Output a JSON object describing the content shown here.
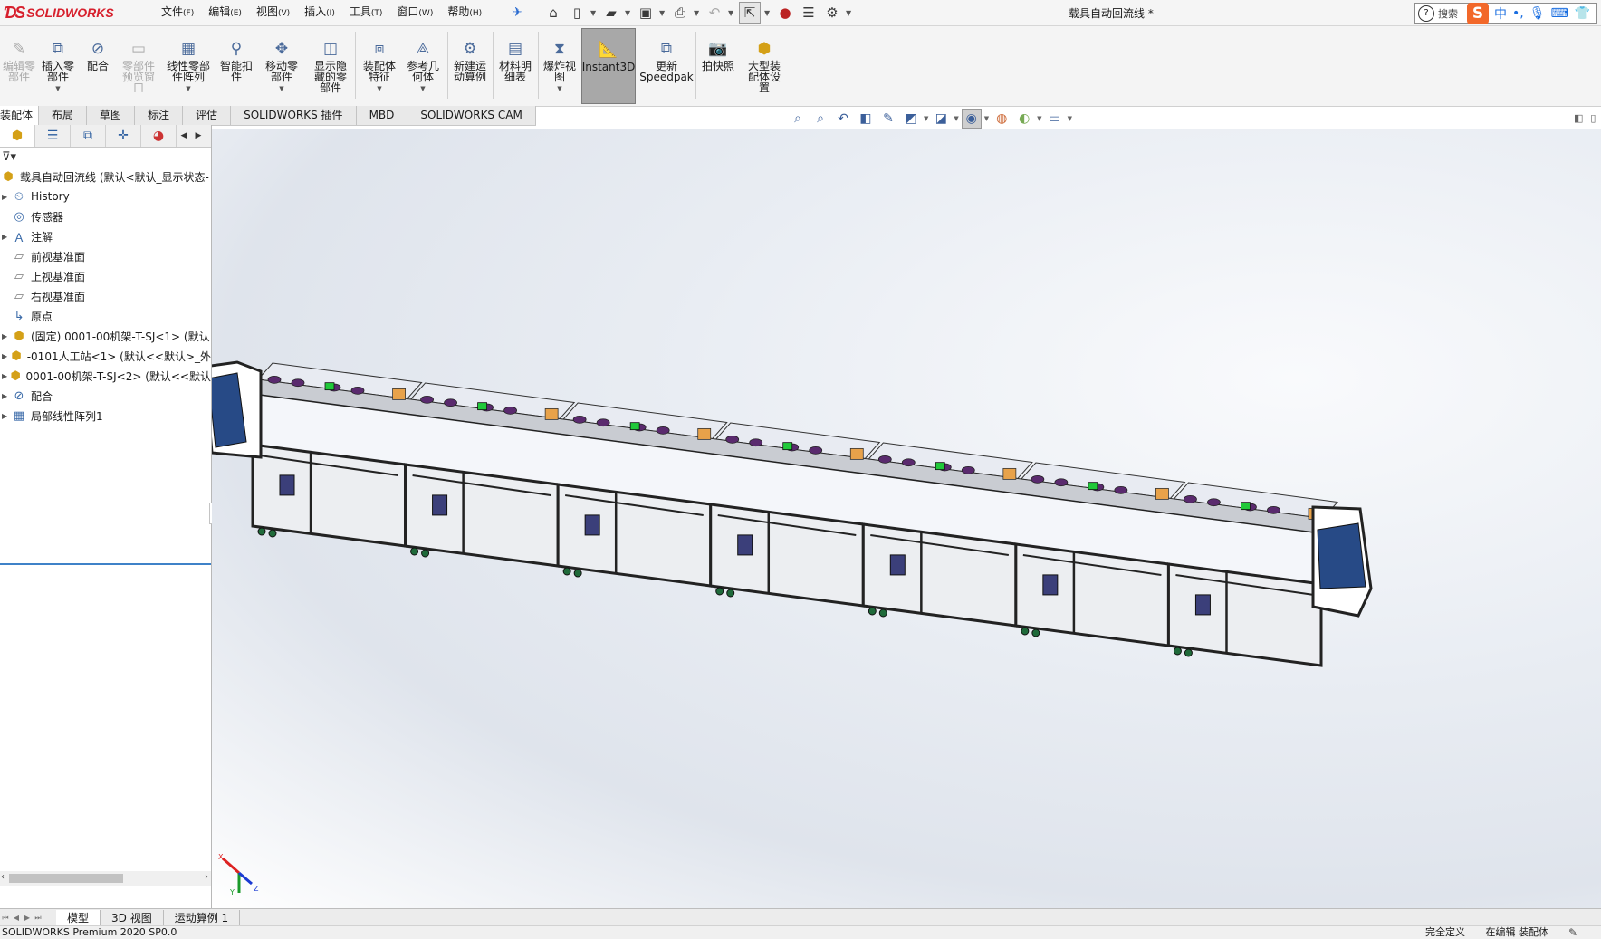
{
  "app": {
    "title": "载具自动回流线 *",
    "brand": "SOLIDWORKS",
    "search_label": "搜索"
  },
  "menu": [
    {
      "label": "文件",
      "key": "(F)"
    },
    {
      "label": "编辑",
      "key": "(E)"
    },
    {
      "label": "视图",
      "key": "(V)"
    },
    {
      "label": "插入",
      "key": "(I)"
    },
    {
      "label": "工具",
      "key": "(T)"
    },
    {
      "label": "窗口",
      "key": "(W)"
    },
    {
      "label": "帮助",
      "key": "(H)"
    }
  ],
  "ribbon": {
    "b0": "编辑零\n部件",
    "b1": "插入零\n部件",
    "b2": "配合",
    "b3": "零部件\n预览窗\n口",
    "b4": "线性零部\n件阵列",
    "b5": "智能扣\n件",
    "b6": "移动零\n部件",
    "b7": "显示隐\n藏的零\n部件",
    "b8": "装配体\n特征",
    "b9": "参考几\n何体",
    "b10": "新建运\n动算例",
    "b11": "材料明\n细表",
    "b12": "爆炸视\n图",
    "b13": "Instant3D",
    "b14": "更新\nSpeedpak",
    "b15": "拍快照",
    "b16": "大型装\n配体设\n置"
  },
  "tabs": [
    "装配体",
    "布局",
    "草图",
    "标注",
    "评估",
    "SOLIDWORKS 插件",
    "MBD",
    "SOLIDWORKS CAM"
  ],
  "tree": {
    "root": "载具自动回流线 (默认<默认_显示状态-",
    "items": [
      {
        "label": "History",
        "icon": "history-icon",
        "expander": true
      },
      {
        "label": "传感器",
        "icon": "sensor-icon",
        "expander": false
      },
      {
        "label": "注解",
        "icon": "annotation-icon",
        "expander": true
      },
      {
        "label": "前视基准面",
        "icon": "plane-icon",
        "expander": false
      },
      {
        "label": "上视基准面",
        "icon": "plane-icon",
        "expander": false
      },
      {
        "label": "右视基准面",
        "icon": "plane-icon",
        "expander": false
      },
      {
        "label": "原点",
        "icon": "origin-icon",
        "expander": false
      },
      {
        "label": "(固定) 0001-00机架-T-SJ<1> (默认",
        "icon": "assembly-icon",
        "expander": true
      },
      {
        "label": "-0101人工站<1> (默认<<默认>_外",
        "icon": "assembly-icon",
        "expander": true
      },
      {
        "label": "0001-00机架-T-SJ<2> (默认<<默认",
        "icon": "assembly-icon",
        "expander": true
      },
      {
        "label": "配合",
        "icon": "mates-icon",
        "expander": true
      },
      {
        "label": "局部线性阵列1",
        "icon": "pattern-icon",
        "expander": true
      }
    ]
  },
  "bottom_tabs": [
    "模型",
    "3D 视图",
    "运动算例 1"
  ],
  "status": {
    "left": "SOLIDWORKS Premium 2020 SP0.0",
    "right1": "完全定义",
    "right2": "在编辑 装配体"
  },
  "triad": {
    "x": "X",
    "y": "Y",
    "z": "Z"
  },
  "colors": {
    "accent": "#d7202d",
    "tree_line": "#3f82c8",
    "frame": "#222222",
    "frame_cover": "#e8ebf2",
    "enclosure": "#274a86",
    "green_block": "#21c93a",
    "orange_block": "#e8a24a",
    "purple_part": "#5a2a6e"
  }
}
